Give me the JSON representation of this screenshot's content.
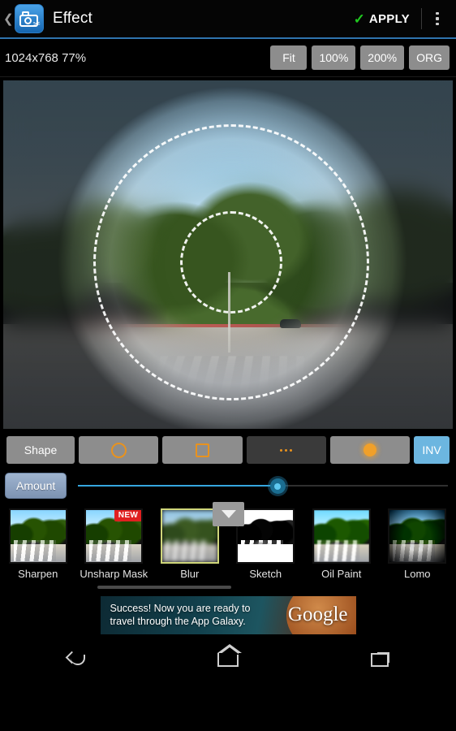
{
  "header": {
    "back_icon": "back-chevron-icon",
    "app_icon": "camera-effect-app-icon",
    "title": "Effect",
    "apply_label": "APPLY",
    "apply_check_icon": "green-check-icon",
    "overflow_icon": "overflow-menu-icon",
    "accent_color": "#2f74ae"
  },
  "infobar": {
    "image_info": "1024x768 77%",
    "zoom_buttons": [
      {
        "label": "Fit"
      },
      {
        "label": "100%"
      },
      {
        "label": "200%"
      },
      {
        "label": "ORG"
      }
    ]
  },
  "canvas": {
    "name": "image-preview-canvas",
    "selection_shape": "circle",
    "outer_guide": "dashed-circle-outer",
    "inner_guide": "dashed-circle-inner"
  },
  "shapebar": {
    "label": "Shape",
    "options": [
      {
        "name": "shape-circle",
        "icon": "circle-outline-icon",
        "selected": false
      },
      {
        "name": "shape-square",
        "icon": "square-outline-icon",
        "selected": false
      },
      {
        "name": "shape-more",
        "icon": "three-dots-icon",
        "selected": true
      },
      {
        "name": "shape-feather",
        "icon": "filled-blob-icon",
        "selected": false
      }
    ],
    "invert_label": "INV",
    "accent_orange": "#e8921e",
    "invert_color": "#6cb6e0"
  },
  "amount": {
    "label": "Amount",
    "value_percent": 54,
    "track_color": "#35a6de"
  },
  "effects": {
    "collapse_icon": "chevron-down-icon",
    "items": [
      {
        "label": "Sharpen",
        "style": "sharp",
        "badge": null,
        "selected": false
      },
      {
        "label": "Unsharp Mask",
        "style": "sharp",
        "badge": "NEW",
        "selected": false
      },
      {
        "label": "Blur",
        "style": "blurred",
        "badge": null,
        "selected": true
      },
      {
        "label": "Sketch",
        "style": "sketch",
        "badge": null,
        "selected": false
      },
      {
        "label": "Oil Paint",
        "style": "oil",
        "badge": null,
        "selected": false
      },
      {
        "label": "Lomo",
        "style": "lomo",
        "badge": null,
        "selected": false
      },
      {
        "label": "",
        "style": "lomo",
        "badge": null,
        "selected": false
      }
    ]
  },
  "ad": {
    "line1": "Success! Now you are ready to",
    "line2": "travel through the App Galaxy.",
    "brand": "Google"
  },
  "navbar": {
    "back_icon": "nav-back-icon",
    "home_icon": "nav-home-icon",
    "recents_icon": "nav-recents-icon"
  }
}
